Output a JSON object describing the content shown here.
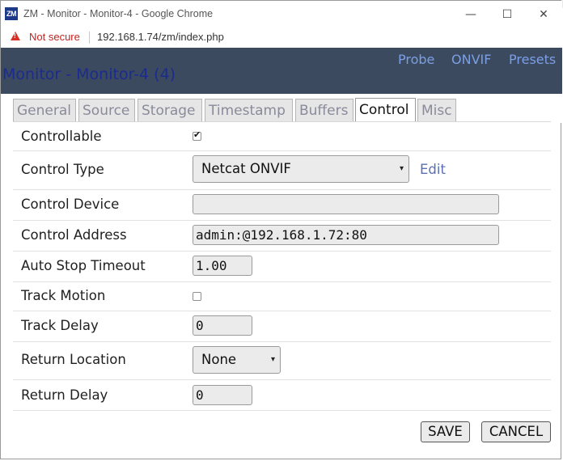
{
  "window": {
    "title": "ZM - Monitor - Monitor-4 - Google Chrome",
    "app_icon_text": "ZM",
    "controls": {
      "minimize": "—",
      "maximize": "☐",
      "close": "✕"
    }
  },
  "address_bar": {
    "security_label": "Not secure",
    "url": "192.168.1.74/zm/index.php"
  },
  "header": {
    "title": "Monitor - Monitor-4 (4)",
    "links": [
      "Probe",
      "ONVIF",
      "Presets"
    ]
  },
  "tabs": [
    {
      "label": "General",
      "active": false
    },
    {
      "label": "Source",
      "active": false
    },
    {
      "label": "Storage",
      "active": false
    },
    {
      "label": "Timestamp",
      "active": false
    },
    {
      "label": "Buffers",
      "active": false
    },
    {
      "label": "Control",
      "active": true
    },
    {
      "label": "Misc",
      "active": false
    }
  ],
  "form": {
    "controllable": {
      "label": "Controllable",
      "checked": true
    },
    "control_type": {
      "label": "Control Type",
      "value": "Netcat ONVIF",
      "edit_label": "Edit"
    },
    "control_device": {
      "label": "Control Device",
      "value": ""
    },
    "control_address": {
      "label": "Control Address",
      "value": "admin:@192.168.1.72:80"
    },
    "auto_stop_timeout": {
      "label": "Auto Stop Timeout",
      "value": "1.00"
    },
    "track_motion": {
      "label": "Track Motion",
      "checked": false
    },
    "track_delay": {
      "label": "Track Delay",
      "value": "0"
    },
    "return_location": {
      "label": "Return Location",
      "value": "None"
    },
    "return_delay": {
      "label": "Return Delay",
      "value": "0"
    }
  },
  "buttons": {
    "save": "SAVE",
    "cancel": "CANCEL"
  },
  "icons": {
    "warning": "warning-triangle-icon",
    "select_arrow": "▾"
  },
  "colors": {
    "header_bg": "#3b4a5e",
    "title": "#1b2b8f",
    "header_link": "#7b9fe6",
    "warning": "#d93025"
  }
}
